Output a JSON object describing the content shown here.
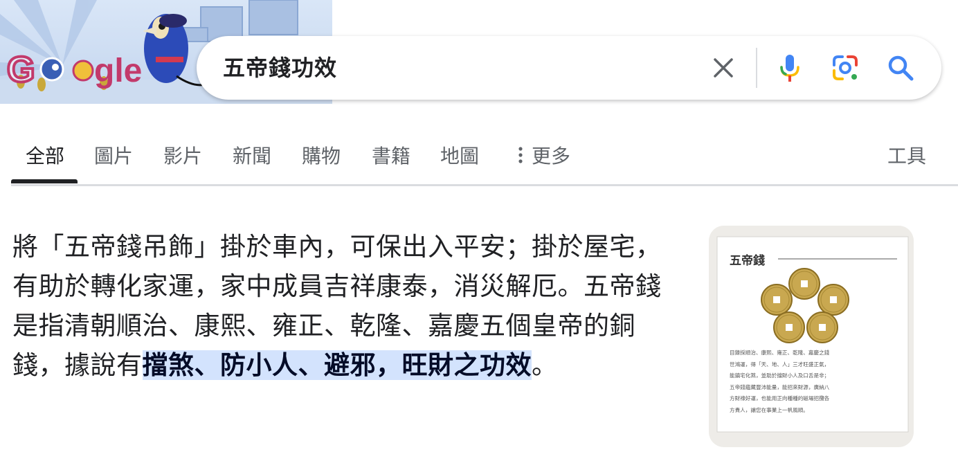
{
  "logo": {
    "alt": "Google",
    "text_visible": "Go gle"
  },
  "search": {
    "query": "五帝錢功效",
    "icons": [
      "close-icon",
      "microphone-icon",
      "google-lens-icon",
      "search-icon"
    ]
  },
  "tabs": [
    {
      "label": "全部",
      "active": true
    },
    {
      "label": "圖片"
    },
    {
      "label": "影片"
    },
    {
      "label": "新聞"
    },
    {
      "label": "購物"
    },
    {
      "label": "書籍"
    },
    {
      "label": "地圖"
    },
    {
      "label": "更多",
      "icon": "more-vert-icon"
    },
    {
      "label": "工具"
    }
  ],
  "snippet": {
    "text_before": "將「五帝錢吊飾」掛於車內，可保出入平安；掛於屋宅，有助於轉化家運，家中成員吉祥康泰，消災解厄。五帝錢是指清朝順治、康熙、雍正、乾隆、嘉慶五個皇帝的銅錢，據說有",
    "highlight": "擋煞、防小人、避邪，旺財之功效",
    "text_after": "。"
  },
  "thumbnail": {
    "title": "五帝錢",
    "caption_lines": [
      "目錄採順治、康熙、雍正、乾隆、嘉慶之錢",
      "世鴻運，得「天、地、人」三才旺盛正氣，",
      "能鎮宅化煞，並助於擋財小人及口舌是非；",
      "五帝錢蘊藏豐沛能量，能招來財源，廣納八",
      "方財祿好運，也能用正向種種的磁場招攬各",
      "方貴人，讓您在事業上一帆風順。"
    ]
  },
  "colors": {
    "google_blue": "#4285f4",
    "google_red": "#ea4335",
    "google_yellow": "#fbbc04",
    "google_green": "#34a853",
    "highlight_bg": "#d3e3fd"
  }
}
